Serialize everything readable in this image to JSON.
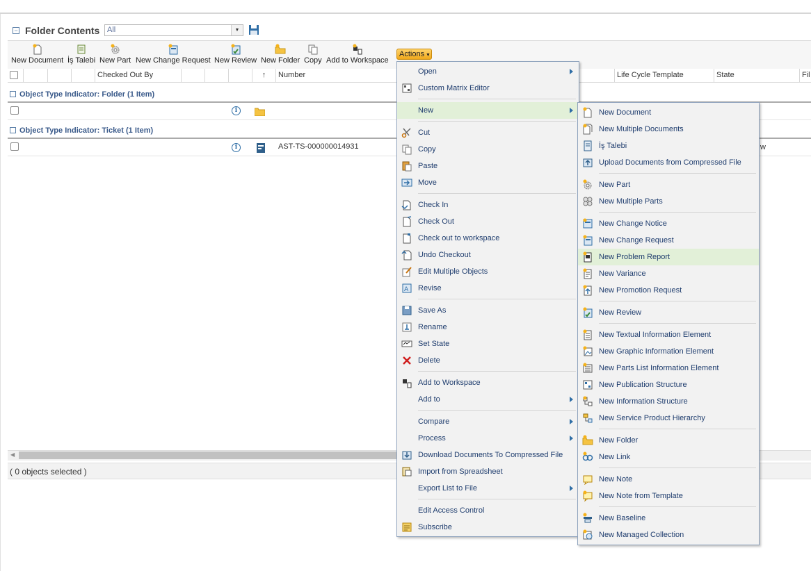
{
  "panel": {
    "title": "Folder Contents",
    "view_selected": "All",
    "status_text": "( 0 objects selected )"
  },
  "toolbar": {
    "new_document": "New Document",
    "is_talebi": "İş Talebi",
    "new_part": "New Part",
    "new_change_request": "New Change Request",
    "new_review": "New Review",
    "new_folder": "New Folder",
    "copy": "Copy",
    "add_to_workspace": "Add to Workspace",
    "actions": "Actions"
  },
  "table": {
    "headers": {
      "checked_out_by": "Checked Out By",
      "sort_arrow": "↑",
      "number": "Number",
      "life_cycle_template": "Life Cycle Template",
      "state": "State",
      "file": "Fil"
    },
    "groups": [
      {
        "label": "Object Type Indicator: Folder (1 Item)"
      },
      {
        "label": "Object Type Indicator: Ticket (1 Item)"
      }
    ],
    "rows": [
      {
        "number": ""
      },
      {
        "number": "AST-TS-000000014931",
        "state_partial": "w"
      }
    ]
  },
  "actions_menu": {
    "items": [
      {
        "label": "Open",
        "icon": "none",
        "submenu": true
      },
      {
        "label": "Custom Matrix Editor",
        "icon": "matrix-icon"
      },
      {
        "label": "New",
        "icon": "none",
        "submenu": true,
        "highlighted": true
      },
      {
        "label": "Cut",
        "icon": "scissors-icon"
      },
      {
        "label": "Copy",
        "icon": "copy-icon"
      },
      {
        "label": "Paste",
        "icon": "paste-icon"
      },
      {
        "label": "Move",
        "icon": "move-icon"
      },
      {
        "label": "Check In",
        "icon": "check-in-icon"
      },
      {
        "label": "Check Out",
        "icon": "check-out-icon"
      },
      {
        "label": "Check out to workspace",
        "icon": "check-out-workspace-icon"
      },
      {
        "label": "Undo Checkout",
        "icon": "undo-checkout-icon"
      },
      {
        "label": "Edit Multiple Objects",
        "icon": "edit-multiple-icon"
      },
      {
        "label": "Revise",
        "icon": "revise-icon"
      },
      {
        "label": "Save As",
        "icon": "save-as-icon"
      },
      {
        "label": "Rename",
        "icon": "rename-icon"
      },
      {
        "label": "Set State",
        "icon": "set-state-icon"
      },
      {
        "label": "Delete",
        "icon": "delete-icon"
      },
      {
        "label": "Add to Workspace",
        "icon": "add-workspace-icon"
      },
      {
        "label": "Add to",
        "icon": "none",
        "submenu": true
      },
      {
        "label": "Compare",
        "icon": "none",
        "submenu": true
      },
      {
        "label": "Process",
        "icon": "none",
        "submenu": true
      },
      {
        "label": "Download Documents To Compressed File",
        "icon": "download-icon"
      },
      {
        "label": "Import from Spreadsheet",
        "icon": "import-icon"
      },
      {
        "label": "Export List to File",
        "icon": "none",
        "submenu": true
      },
      {
        "label": "Edit Access Control",
        "icon": "none"
      },
      {
        "label": "Subscribe",
        "icon": "subscribe-icon"
      }
    ]
  },
  "new_submenu": {
    "items": [
      {
        "label": "New Document",
        "icon": "new-document-icon"
      },
      {
        "label": "New Multiple Documents",
        "icon": "new-multiple-documents-icon"
      },
      {
        "label": "İş Talebi",
        "icon": "ticket-icon"
      },
      {
        "label": "Upload Documents from Compressed File",
        "icon": "upload-compressed-icon"
      },
      {
        "label": "New Part",
        "icon": "gear-icon"
      },
      {
        "label": "New Multiple Parts",
        "icon": "multiple-gears-icon"
      },
      {
        "label": "New Change Notice",
        "icon": "change-notice-icon"
      },
      {
        "label": "New Change Request",
        "icon": "change-request-icon"
      },
      {
        "label": "New Problem Report",
        "icon": "problem-report-icon",
        "highlighted": true
      },
      {
        "label": "New Variance",
        "icon": "variance-icon"
      },
      {
        "label": "New Promotion Request",
        "icon": "promotion-request-icon"
      },
      {
        "label": "New Review",
        "icon": "review-icon"
      },
      {
        "label": "New Textual Information Element",
        "icon": "textual-element-icon"
      },
      {
        "label": "New Graphic Information Element",
        "icon": "graphic-element-icon"
      },
      {
        "label": "New Parts List Information Element",
        "icon": "parts-list-icon"
      },
      {
        "label": "New Publication Structure",
        "icon": "publication-structure-icon"
      },
      {
        "label": "New Information Structure",
        "icon": "information-structure-icon"
      },
      {
        "label": "New Service Product Hierarchy",
        "icon": "service-hierarchy-icon"
      },
      {
        "label": "New Folder",
        "icon": "folder-icon"
      },
      {
        "label": "New Link",
        "icon": "link-icon"
      },
      {
        "label": "New Note",
        "icon": "note-icon"
      },
      {
        "label": "New Note from Template",
        "icon": "note-template-icon"
      },
      {
        "label": "New Baseline",
        "icon": "baseline-icon"
      },
      {
        "label": "New Managed Collection",
        "icon": "managed-collection-icon"
      }
    ]
  },
  "colors": {
    "menu_text": "#1f3d6e",
    "highlight": "#e2f0d8",
    "actions_button": "#f0a81a",
    "group_text": "#3a5a8a"
  }
}
